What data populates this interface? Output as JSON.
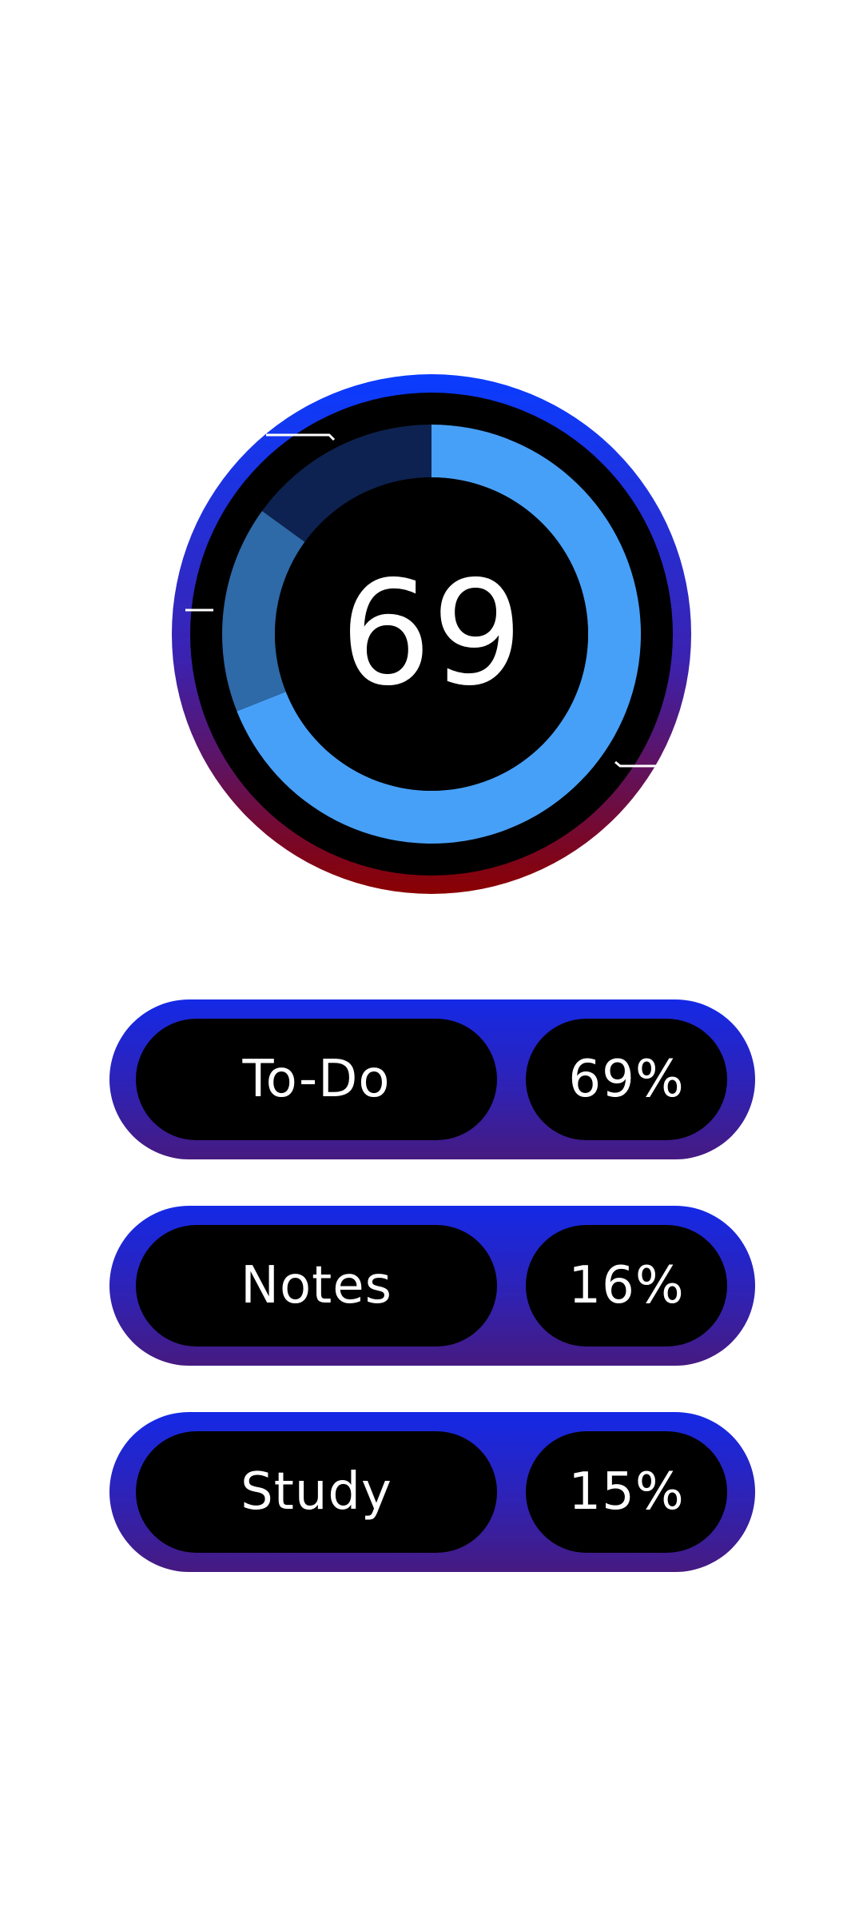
{
  "donut": {
    "center_value": "69",
    "colors": {
      "ring_top": "#0a3cff",
      "ring_mid": "#3b22b0",
      "ring_bottom": "#8b0000",
      "inner_bg": "#000000",
      "seg_todo": "#47a0f8",
      "seg_notes": "#2e69a8",
      "seg_study": "#0d2250"
    }
  },
  "chart_data": {
    "type": "pie",
    "categories": [
      "To-Do",
      "Notes",
      "Study"
    ],
    "values": [
      69,
      16,
      15
    ],
    "title": "",
    "center_label": "69"
  },
  "categories": [
    {
      "name": "To-Do",
      "percent": "69%"
    },
    {
      "name": "Notes",
      "percent": "16%"
    },
    {
      "name": "Study",
      "percent": "15%"
    }
  ]
}
